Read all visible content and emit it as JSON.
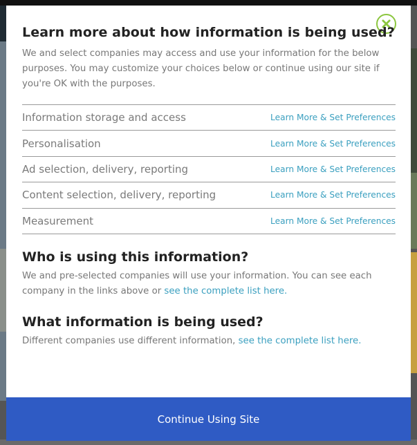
{
  "modal": {
    "title": "Learn more about how information is being used?",
    "intro": "We and select companies may access and use your information for the below purposes. You may customize your choices below or continue using our site if you're OK with the purposes.",
    "close_icon": "close-icon",
    "purposes": [
      {
        "name": "Information storage and access",
        "link": "Learn More & Set Preferences"
      },
      {
        "name": "Personalisation",
        "link": "Learn More & Set Preferences"
      },
      {
        "name": "Ad selection, delivery, reporting",
        "link": "Learn More & Set Preferences"
      },
      {
        "name": "Content selection, delivery, reporting",
        "link": "Learn More & Set Preferences"
      },
      {
        "name": "Measurement",
        "link": "Learn More & Set Preferences"
      }
    ],
    "who": {
      "title": "Who is using this information?",
      "text": "We and pre-selected companies will use your information. You can see each company in the links above or ",
      "link": "see the complete list here."
    },
    "what": {
      "title": "What information is being used?",
      "text": "Different companies use different information, ",
      "link": "see the complete list here."
    },
    "continue_label": "Continue Using Site"
  },
  "colors": {
    "accent_link": "#3a9fbf",
    "button_bg": "#2f5bc4",
    "close_ring": "#8cc63f"
  }
}
